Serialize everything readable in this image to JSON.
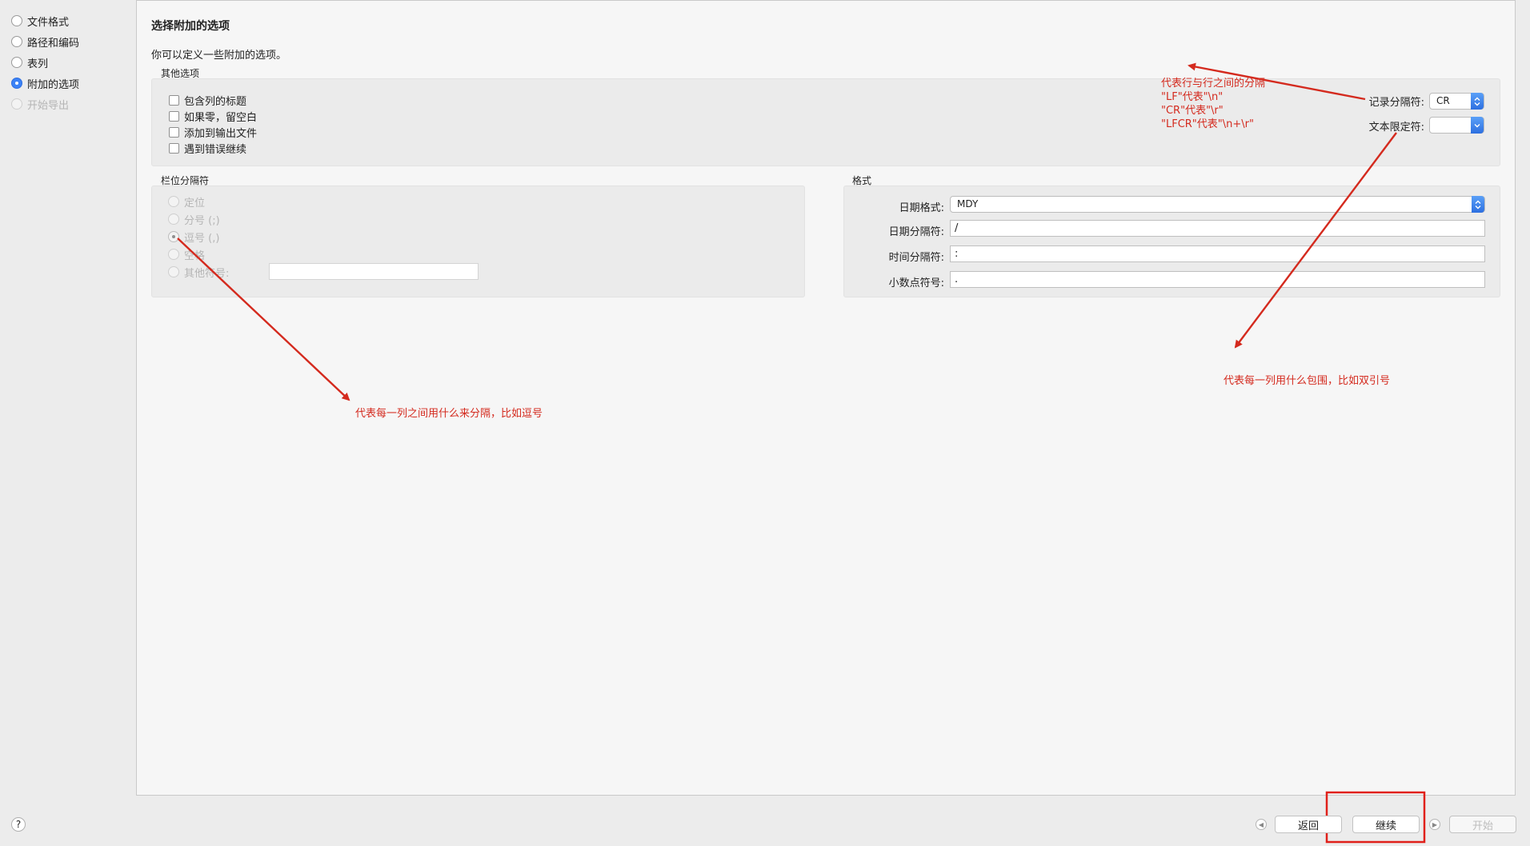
{
  "sidebar": {
    "steps": [
      {
        "label": "文件格式"
      },
      {
        "label": "路径和编码"
      },
      {
        "label": "表列"
      },
      {
        "label": "附加的选项"
      },
      {
        "label": "开始导出"
      }
    ],
    "help": "?"
  },
  "page": {
    "title": "选择附加的选项",
    "subtitle": "你可以定义一些附加的选项。"
  },
  "other_options": {
    "title": "其他选项",
    "checkboxes": [
      {
        "label": "包含列的标题"
      },
      {
        "label": "如果零，留空白"
      },
      {
        "label": "添加到输出文件"
      },
      {
        "label": "遇到错误继续"
      }
    ],
    "record_separator_label": "记录分隔符:",
    "record_separator_value": "CR",
    "text_qualifier_label": "文本限定符:",
    "text_qualifier_value": ""
  },
  "field_separator": {
    "title": "栏位分隔符",
    "options": [
      {
        "label": "定位"
      },
      {
        "label": "分号 (;)"
      },
      {
        "label": "逗号 (,)"
      },
      {
        "label": "空格"
      },
      {
        "label": "其他符号:"
      }
    ],
    "other_value": ""
  },
  "format": {
    "title": "格式",
    "date_format_label": "日期格式:",
    "date_format_value": "MDY",
    "date_sep_label": "日期分隔符:",
    "date_sep_value": "/",
    "time_sep_label": "时间分隔符:",
    "time_sep_value": ":",
    "decimal_label": "小数点符号:",
    "decimal_value": "."
  },
  "annotations": {
    "row_sep_1": "代表行与行之间的分隔",
    "row_sep_2": "\"LF\"代表\"\\n\"",
    "row_sep_3": "\"CR\"代表\"\\r\"",
    "row_sep_4": "\"LFCR\"代表\"\\n+\\r\"",
    "qualifier": "代表每一列用什么包围，比如双引号",
    "column_sep": "代表每一列之间用什么来分隔，比如逗号"
  },
  "footer": {
    "back": "返回",
    "continue": "继续",
    "start": "开始"
  },
  "colors": {
    "annotation": "#d42a1e",
    "accent": "#3b82f6"
  }
}
